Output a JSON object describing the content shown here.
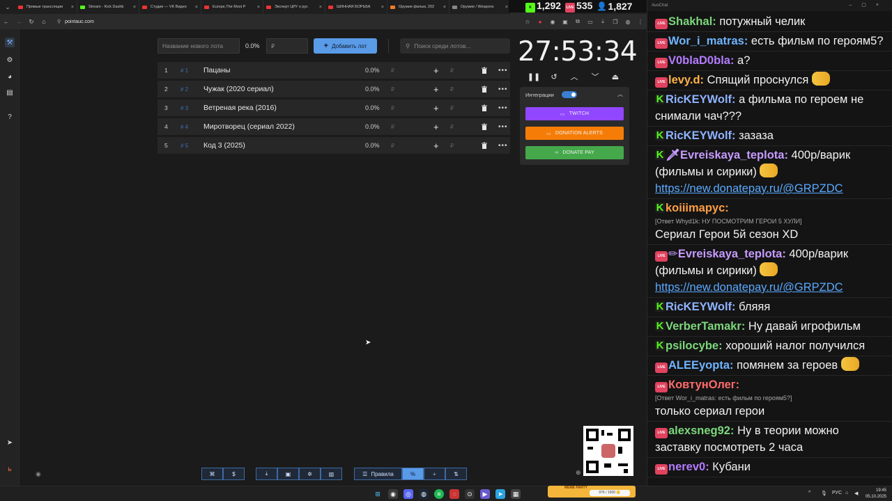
{
  "browser": {
    "tabs": [
      {
        "label": "Прямые трансляции",
        "color": "#e33"
      },
      {
        "label": "Stream - Kick Dashb",
        "color": "#53fc18"
      },
      {
        "label": "Студия — VK Видео",
        "color": "#e33"
      },
      {
        "label": "Europe,The Most P",
        "color": "#e33"
      },
      {
        "label": "Эксперт ЦРУ о рус",
        "color": "#e33"
      },
      {
        "label": "ШИННАЯ БОРЬБА",
        "color": "#e33"
      },
      {
        "label": "Оружие фильм, 202",
        "color": "#f07b28"
      },
      {
        "label": "Оружие / Weapons",
        "color": "#888"
      },
      {
        "label": "Po",
        "color": "#e33"
      }
    ],
    "url": "pointauc.com"
  },
  "stream_stats": {
    "kick": "1,292",
    "vk": "535",
    "viewers": "1,827"
  },
  "auction": {
    "lot_name_placeholder": "Название нового лота",
    "new_pct": "0.0%",
    "price_placeholder": "₽",
    "add_button": "Добавить лот",
    "search_placeholder": "Поиск среди лотов...",
    "lots": [
      {
        "num": "1",
        "id": "# 1",
        "title": "Пацаны",
        "pct": "0.0%",
        "rub": "₽"
      },
      {
        "num": "2",
        "id": "# 2",
        "title": "Чужак (2020 сериал)",
        "pct": "0.0%",
        "rub": "₽"
      },
      {
        "num": "3",
        "id": "# 3",
        "title": "Ветреная река (2016)",
        "pct": "0.0%",
        "rub": "₽"
      },
      {
        "num": "4",
        "id": "# 4",
        "title": "Миротворец (сериал 2022)",
        "pct": "0.0%",
        "rub": "₽"
      },
      {
        "num": "5",
        "id": "# 5",
        "title": "Код 3 (2025)",
        "pct": "0.0%",
        "rub": "₽"
      }
    ],
    "timer": "27:53:34",
    "integrations": {
      "label": "Интеграции",
      "twitch": "TWITCH",
      "donation_alerts": "DONATION ALERTS",
      "donate_pay": "DONATE PAY",
      "colors": {
        "twitch": "#9146ff",
        "donation_alerts": "#f57d07",
        "donate_pay": "#45a94b"
      }
    },
    "rules_button": "Правила"
  },
  "chat": {
    "title": "AuoChat",
    "messages": [
      {
        "badge": "live",
        "user": "Shakhal:",
        "color": "#7cd77c",
        "text": " потужный челик"
      },
      {
        "badge": "live",
        "user": "Wor_i_matras:",
        "color": "#6fb4ff",
        "text": " есть фильм по героям5?"
      },
      {
        "badge": "live",
        "user": "V0blaD0bla:",
        "color": "#b37cff",
        "text": " а?"
      },
      {
        "badge": "live",
        "user": "levy.d:",
        "color": "#ffb347",
        "text": " Спящий проснулся",
        "emote": true
      },
      {
        "badge": "kick",
        "user": "RicKEYWolf:",
        "color": "#8fb3ff",
        "text": " а фильма по героем не снимали чач???"
      },
      {
        "badge": "kick",
        "user": "RicKEYWolf:",
        "color": "#8fb3ff",
        "text": " зазаза"
      },
      {
        "badge": "kick",
        "user": "🗡Evreiskaya_teplota:",
        "color": "#c79bff",
        "text": " 400р/варик (фильмы и сирики)",
        "emote": true,
        "link": "https://new.donatepay.ru/@GRPZDC"
      },
      {
        "badge": "kick",
        "user": "koiiimapyc:",
        "color": "#ff9f43",
        "text": "",
        "reply": "[Ответ Whyd1k: НУ ПОСМОТРИМ ГЕРОИ 5 ХУЛИ]",
        "after": "Сериал Герои 5й сезон XD"
      },
      {
        "badge": "live",
        "user": "✏Evreiskaya_teplota:",
        "color": "#c79bff",
        "text": " 400р/варик (фильмы и сирики)",
        "emote": true,
        "link": "https://new.donatepay.ru/@GRPZDC"
      },
      {
        "badge": "kick",
        "user": "RicKEYWolf:",
        "color": "#8fb3ff",
        "text": " бляяя"
      },
      {
        "badge": "kick",
        "user": "VerberTamakr:",
        "color": "#7cd77c",
        "text": " Ну давай игрофильм"
      },
      {
        "badge": "kick",
        "user": "psilocybe:",
        "color": "#7cd77c",
        "text": " хороший налог получился"
      },
      {
        "badge": "live",
        "user": "ALEEyopta:",
        "color": "#6fb4ff",
        "text": " помянем за героев",
        "emote": true
      },
      {
        "badge": "live",
        "user": "КовтунОлег:",
        "color": "#ff6b6b",
        "text": "",
        "reply": "[Ответ Wor_i_matras: есть фильм по героям5?]",
        "after": "только сериал герои"
      },
      {
        "badge": "live",
        "user": "alexsneg92:",
        "color": "#7cd77c",
        "text": " Ну в теории можно заставку посмотреть 2 часа"
      },
      {
        "badge": "live",
        "user": "nerev0:",
        "color": "#b37cff",
        "text": " Кубани"
      }
    ]
  },
  "taskbar": {
    "meme_party": "MEME PARTY",
    "meme_count": "976 / 1500 🪙",
    "lang": "РУС",
    "time": "19:45",
    "date": "05.10.2025"
  }
}
